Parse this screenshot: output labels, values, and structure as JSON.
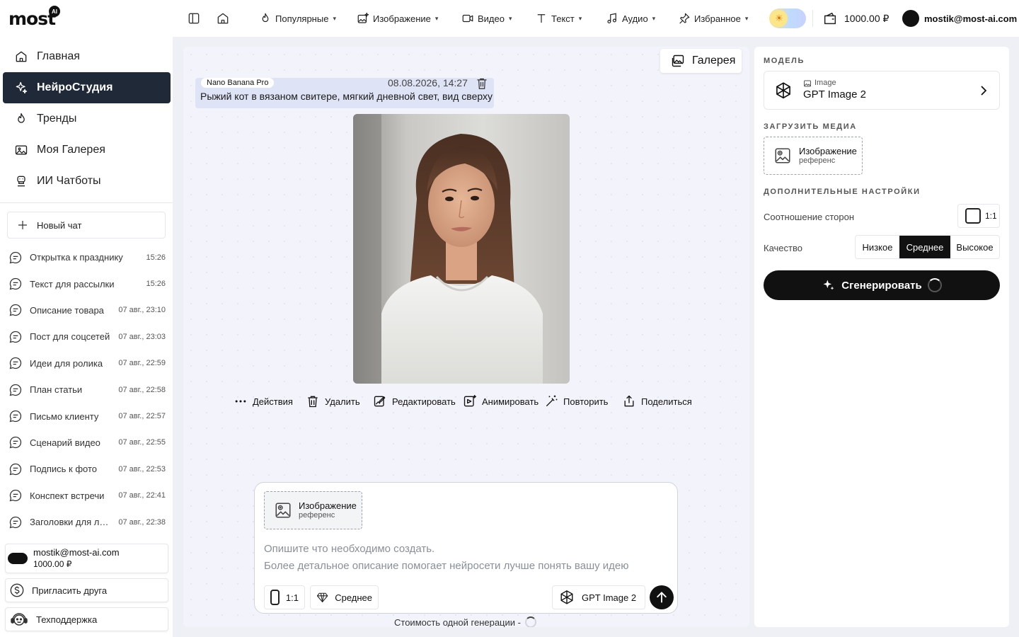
{
  "brand": {
    "logo": "most",
    "badge": "AI"
  },
  "sidebar": {
    "nav": [
      {
        "label": "Главная",
        "icon": "home-icon"
      },
      {
        "label": "НейроСтудия",
        "icon": "sparkles-icon",
        "active": true
      },
      {
        "label": "Тренды",
        "icon": "flame-icon"
      },
      {
        "label": "Моя Галерея",
        "icon": "gallery-icon"
      },
      {
        "label": "ИИ Чатботы",
        "icon": "bot-icon"
      }
    ],
    "new_chat": "Новый чат",
    "chats": [
      {
        "title": "Открытка к празднику",
        "time": "15:26"
      },
      {
        "title": "Текст для рассылки",
        "time": "15:26"
      },
      {
        "title": "Описание товара",
        "time": "07 авг., 23:10"
      },
      {
        "title": "Пост для соцсетей",
        "time": "07 авг., 23:03"
      },
      {
        "title": "Идеи для ролика",
        "time": "07 авг., 22:59"
      },
      {
        "title": "План статьи",
        "time": "07 авг., 22:58"
      },
      {
        "title": "Письмо клиенту",
        "time": "07 авг., 22:57"
      },
      {
        "title": "Сценарий видео",
        "time": "07 авг., 22:55"
      },
      {
        "title": "Подпись к фото",
        "time": "07 авг., 22:53"
      },
      {
        "title": "Конспект встречи",
        "time": "07 авг., 22:41"
      },
      {
        "title": "Заголовки для лен…",
        "time": "07 авг., 22:38"
      }
    ],
    "account": {
      "email": "mostik@most-ai.com",
      "balance": "1000.00 ₽"
    },
    "invite": "Пригласить друга",
    "support": "Техподдержка"
  },
  "topbar": {
    "menus": [
      {
        "label": "Популярные",
        "icon": "flame-icon"
      },
      {
        "label": "Изображение",
        "icon": "image-sparkle-icon"
      },
      {
        "label": "Видео",
        "icon": "video-icon"
      },
      {
        "label": "Текст",
        "icon": "text-icon"
      },
      {
        "label": "Аудио",
        "icon": "music-icon"
      },
      {
        "label": "Избранное",
        "icon": "pin-icon"
      }
    ],
    "balance": "1000.00 ₽",
    "user_email": "mostik@most-ai.com"
  },
  "main": {
    "gallery_button": "Галерея",
    "prompt": {
      "model_tag": "Nano Banana Pro",
      "date": "08.08.2026, 14:27",
      "text": "Рыжий кот в вязаном свитере, мягкий дневной свет, вид сверху"
    },
    "actions": [
      "Действия",
      "Удалить",
      "Редактировать",
      "Анимировать",
      "Повторить",
      "Поделиться"
    ],
    "composer": {
      "ref_title": "Изображение",
      "ref_subtitle": "референс",
      "placeholder_line1": "Опишите что необходимо создать.",
      "placeholder_line2": "Более детальное описание помогает нейросети лучше понять вашу идею",
      "ratio": "1:1",
      "quality": "Среднее",
      "model": "GPT Image 2"
    },
    "cost_label": "Стоимость одной генерации -"
  },
  "right_panel": {
    "model_section": "МОДЕЛЬ",
    "model_kind": "Image",
    "model_name": "GPT Image 2",
    "upload_section": "ЗАГРУЗИТЬ МЕДИА",
    "upload_title": "Изображение",
    "upload_subtitle": "референс",
    "extra_section": "ДОПОЛНИТЕЛЬНЫЕ НАСТРОЙКИ",
    "aspect_label": "Соотношение сторон",
    "aspect_value": "1:1",
    "quality_label": "Качество",
    "quality_options": [
      "Низкое",
      "Среднее",
      "Высокое"
    ],
    "quality_selected": "Среднее",
    "generate_button": "Сгенерировать"
  }
}
